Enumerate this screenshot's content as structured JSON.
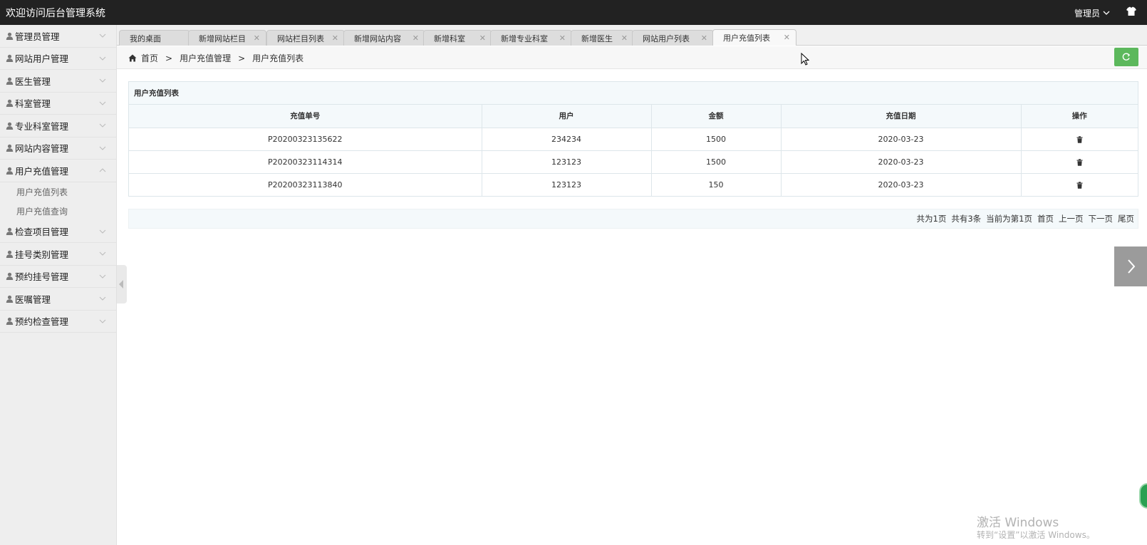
{
  "app": {
    "title": "欢迎访问后台管理系统",
    "user_label": "管理员"
  },
  "sidebar": {
    "items": [
      {
        "label": "管理员管理",
        "expanded": false
      },
      {
        "label": "网站用户管理",
        "expanded": false
      },
      {
        "label": "医生管理",
        "expanded": false
      },
      {
        "label": "科室管理",
        "expanded": false
      },
      {
        "label": "专业科室管理",
        "expanded": false
      },
      {
        "label": "网站内容管理",
        "expanded": false
      },
      {
        "label": "用户充值管理",
        "expanded": true,
        "children": [
          "用户充值列表",
          "用户充值查询"
        ]
      },
      {
        "label": "检查项目管理",
        "expanded": false
      },
      {
        "label": "挂号类别管理",
        "expanded": false
      },
      {
        "label": "预约挂号管理",
        "expanded": false
      },
      {
        "label": "医嘱管理",
        "expanded": false
      },
      {
        "label": "预约检查管理",
        "expanded": false
      }
    ]
  },
  "tabs": [
    {
      "label": "我的桌面",
      "closable": false
    },
    {
      "label": "新增网站栏目",
      "closable": true
    },
    {
      "label": "网站栏目列表",
      "closable": true
    },
    {
      "label": "新增网站内容",
      "closable": true
    },
    {
      "label": "新增科室",
      "closable": true
    },
    {
      "label": "新增专业科室",
      "closable": true
    },
    {
      "label": "新增医生",
      "closable": true
    },
    {
      "label": "网站用户列表",
      "closable": true
    },
    {
      "label": "用户充值列表",
      "closable": true,
      "active": true
    }
  ],
  "breadcrumb": {
    "home": "首页",
    "level1": "用户充值管理",
    "level2": "用户充值列表",
    "sep": ">"
  },
  "panel": {
    "title": "用户充值列表",
    "columns": [
      "充值单号",
      "用户",
      "金额",
      "充值日期",
      "操作"
    ],
    "rows": [
      {
        "order_no": "P20200323135622",
        "user": "234234",
        "amount": "1500",
        "date": "2020-03-23"
      },
      {
        "order_no": "P20200323114314",
        "user": "123123",
        "amount": "1500",
        "date": "2020-03-23"
      },
      {
        "order_no": "P20200323113840",
        "user": "123123",
        "amount": "150",
        "date": "2020-03-23"
      }
    ]
  },
  "pager": {
    "total_pages": "共为1页",
    "total_items": "共有3条",
    "current": "当前为第1页",
    "first": "首页",
    "prev": "上一页",
    "next": "下一页",
    "last": "尾页"
  },
  "watermark": {
    "line1": "激活 Windows",
    "line2": "转到“设置”以激活 Windows。"
  },
  "colors": {
    "topbar": "#222222",
    "refresh": "#5cb85c",
    "panel_head": "#f4f9fb"
  }
}
